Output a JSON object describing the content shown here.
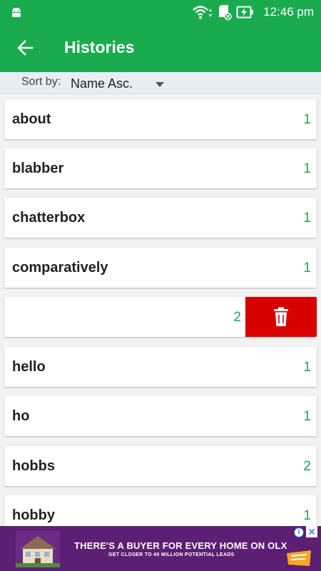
{
  "status_bar": {
    "time": "12:46 pm",
    "icons": [
      "android-icon",
      "wifi-icon",
      "sd-card-icon",
      "battery-charging-icon"
    ]
  },
  "app_bar": {
    "title": "Histories",
    "back_icon": "arrow-left-icon"
  },
  "sort": {
    "label": "Sort by:",
    "selected": "Name Asc."
  },
  "list": {
    "items": [
      {
        "word": "about",
        "count": "1"
      },
      {
        "word": "blabber",
        "count": "1"
      },
      {
        "word": "chatterbox",
        "count": "1"
      },
      {
        "word": "comparatively",
        "count": "1"
      },
      {
        "word": "",
        "count": "2",
        "swiped": true
      },
      {
        "word": "hello",
        "count": "1"
      },
      {
        "word": "ho",
        "count": "1"
      },
      {
        "word": "hobbs",
        "count": "2"
      },
      {
        "word": "hobby",
        "count": "1"
      }
    ],
    "delete_icon": "trash-icon"
  },
  "ad": {
    "headline": "THERE'S A BUYER FOR EVERY HOME ON OLX",
    "subline": "GET CLOSER TO 40 MILLION POTENTIAL LEADS",
    "info_icon": "info-icon",
    "close_icon": "close-icon"
  },
  "colors": {
    "accent": "#1aab4f",
    "delete": "#d80000",
    "ad_background": "#5c1f73"
  }
}
